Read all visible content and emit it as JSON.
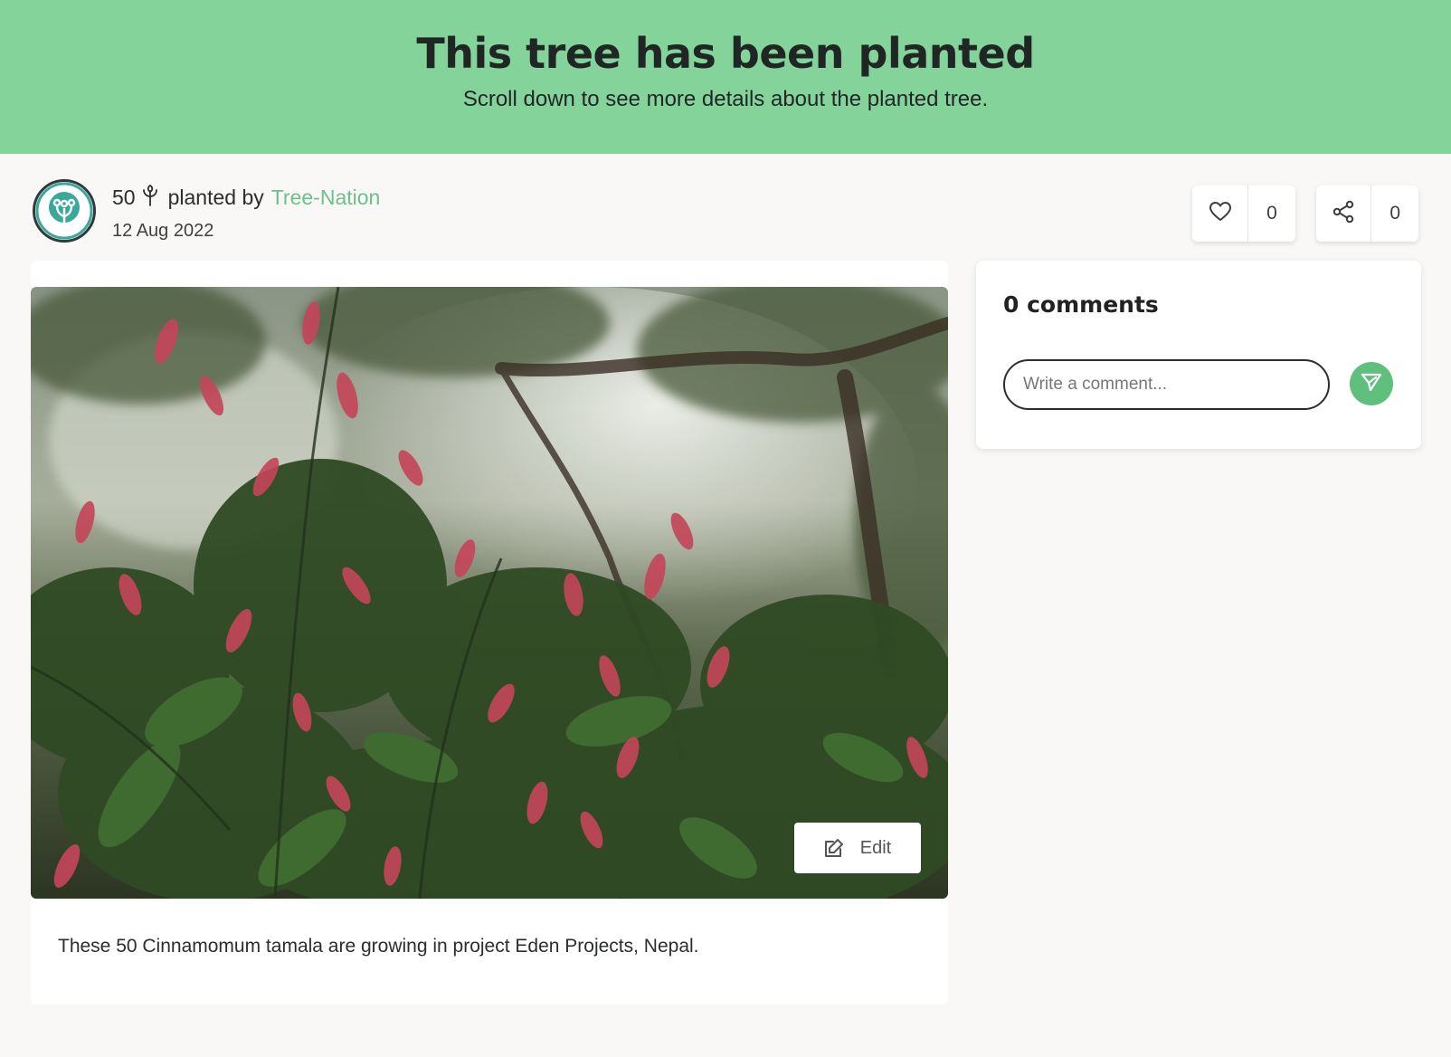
{
  "banner": {
    "title": "This tree has been planted",
    "subtitle": "Scroll down to see more details about the planted tree."
  },
  "planter": {
    "count": "50",
    "planted_by_label": "planted by",
    "org_name": "Tree-Nation",
    "date": "12 Aug 2022",
    "avatar_icon": "tree-nation-logo-icon"
  },
  "actions": {
    "likes": "0",
    "shares": "0",
    "like_icon": "heart-icon",
    "share_icon": "share-icon"
  },
  "post": {
    "edit_label": "Edit",
    "description": "These 50 Cinnamomum tamala are growing in project Eden Projects, Nepal."
  },
  "comments": {
    "heading": "0 comments",
    "placeholder": "Write a comment...",
    "send_icon": "send-icon"
  },
  "colors": {
    "banner": "#84d39a",
    "accent": "#6cc08a",
    "send_button": "#5fbf7c"
  }
}
